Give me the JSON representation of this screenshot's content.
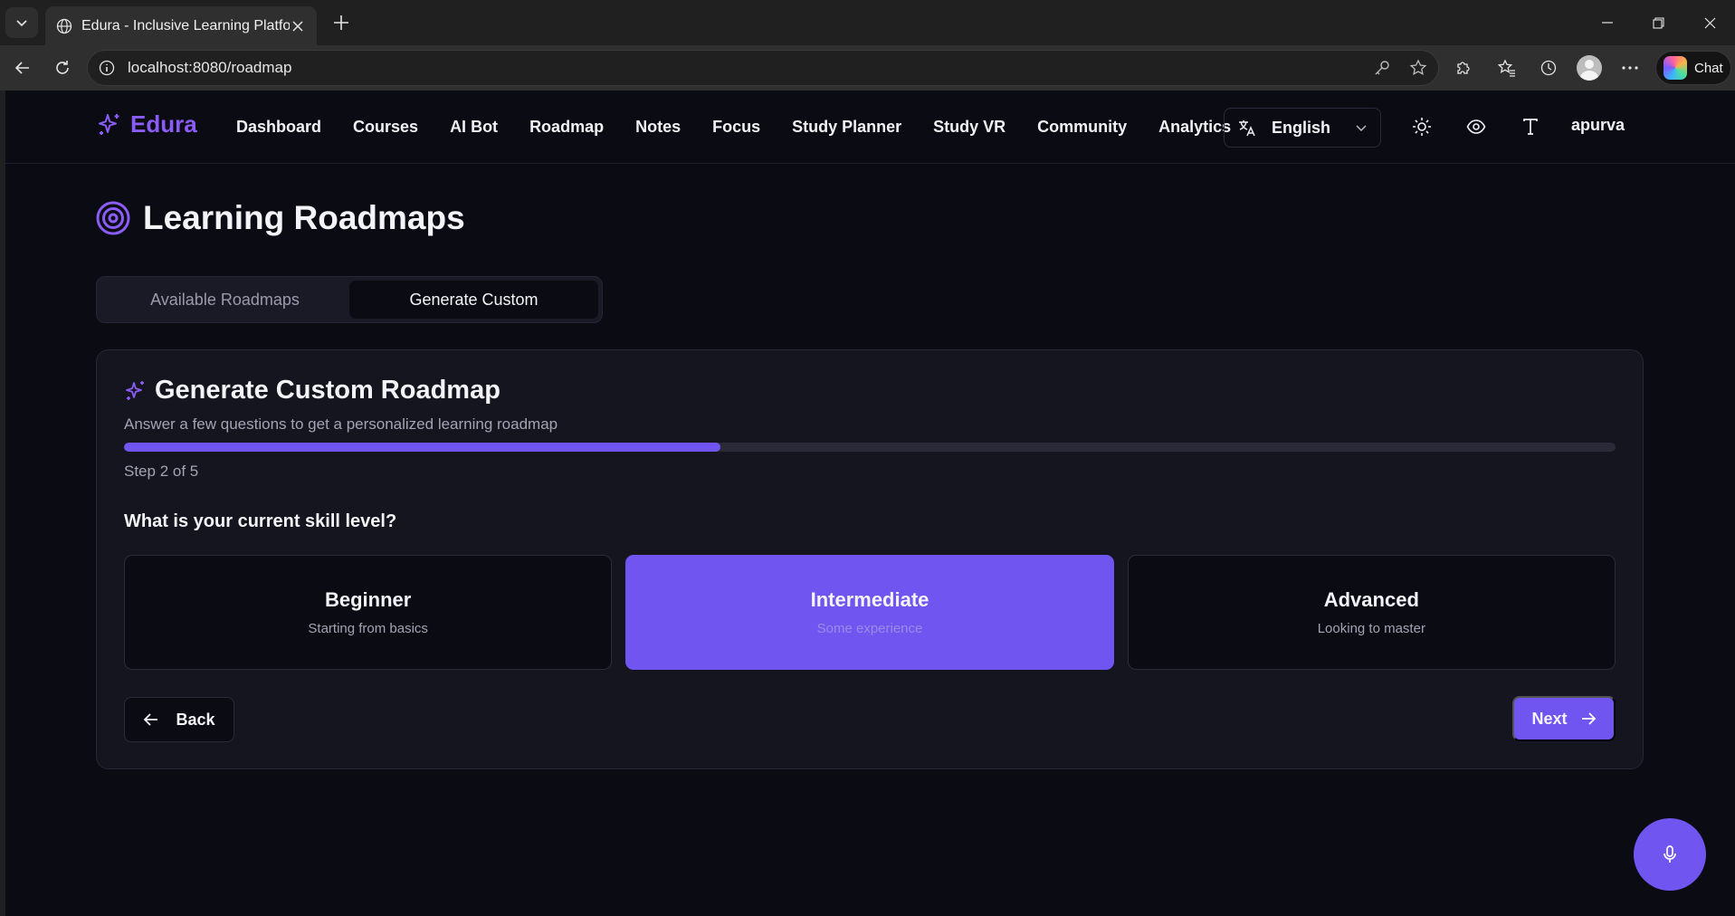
{
  "browser": {
    "tab_title": "Edura - Inclusive Learning Platform",
    "url": "localhost:8080/roadmap",
    "chat_label": "Chat"
  },
  "header": {
    "brand": "Edura",
    "nav": [
      "Dashboard",
      "Courses",
      "AI Bot",
      "Roadmap",
      "Notes",
      "Focus",
      "Study Planner",
      "Study VR",
      "Community",
      "Analytics"
    ],
    "language": "English",
    "username": "apurva"
  },
  "page": {
    "title": "Learning Roadmaps",
    "tabs": [
      {
        "label": "Available Roadmaps",
        "active": false
      },
      {
        "label": "Generate Custom",
        "active": true
      }
    ]
  },
  "card": {
    "title": "Generate Custom Roadmap",
    "subtitle": "Answer a few questions to get a personalized learning roadmap",
    "progress_fraction": 0.4,
    "step_label": "Step 2 of 5",
    "question": "What is your current skill level?",
    "options": [
      {
        "title": "Beginner",
        "desc": "Starting from basics",
        "selected": false
      },
      {
        "title": "Intermediate",
        "desc": "Some experience",
        "selected": true
      },
      {
        "title": "Advanced",
        "desc": "Looking to master",
        "selected": false
      }
    ],
    "back_label": "Back",
    "next_label": "Next"
  },
  "colors": {
    "accent": "#7155f1",
    "brand": "#8b5cf6",
    "background": "#0b0b14"
  },
  "icons": {
    "brand": "sparkle-icon",
    "title": "target-icon",
    "card": "sparkles-icon",
    "mic": "microphone-icon"
  }
}
